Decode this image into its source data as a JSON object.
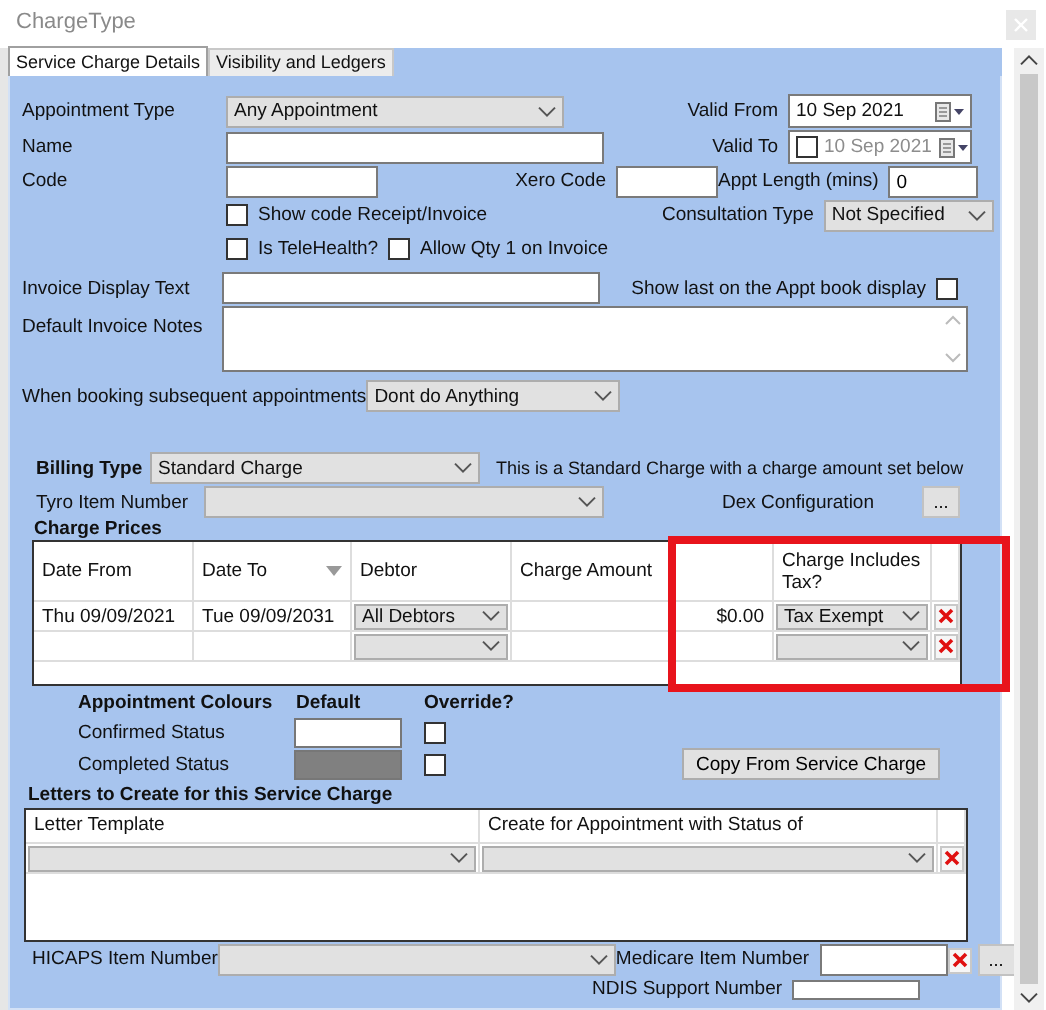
{
  "window": {
    "title": "ChargeType"
  },
  "tabs": [
    {
      "label": "Service Charge Details",
      "selected": true
    },
    {
      "label": "Visibility and Ledgers",
      "selected": false
    }
  ],
  "appointment_type": {
    "label": "Appointment Type",
    "value": "Any Appointment"
  },
  "valid_from": {
    "label": "Valid From",
    "value": "10 Sep 2021"
  },
  "name": {
    "label": "Name"
  },
  "valid_to": {
    "label": "Valid To",
    "value": "10 Sep 2021",
    "checked": false
  },
  "code": {
    "label": "Code"
  },
  "xero_code": {
    "label": "Xero Code"
  },
  "appt_length": {
    "label": "Appt Length (mins)",
    "value": "0"
  },
  "checkboxes": [
    {
      "label": "Show code Receipt/Invoice",
      "checked": false
    },
    {
      "label": "Is TeleHealth?",
      "checked": false
    },
    {
      "label": "Allow Qty 1 on Invoice",
      "checked": false
    }
  ],
  "consultation_type": {
    "label": "Consultation Type",
    "value": "Not Specified"
  },
  "invoice_display_text": {
    "label": "Invoice Display Text"
  },
  "show_last": {
    "label": "Show last on the Appt book display",
    "checked": false
  },
  "default_invoice_notes": {
    "label": "Default Invoice Notes"
  },
  "subsequent_appointments": {
    "label": "When booking subsequent appointments",
    "value": "Dont do Anything"
  },
  "billing_type": {
    "label": "Billing Type",
    "value": "Standard Charge",
    "note": "This is a Standard Charge with a charge amount set below"
  },
  "tyro_item_number": {
    "label": "Tyro Item Number"
  },
  "dex_configuration": {
    "label": "Dex Configuration",
    "button": "..."
  },
  "charge_prices": {
    "title": "Charge Prices",
    "columns": [
      {
        "label": "Date From",
        "sorted": false
      },
      {
        "label": "Date To",
        "sorted": true
      },
      {
        "label": "Debtor",
        "sorted": false
      },
      {
        "label": "Charge Amount",
        "sorted": false
      },
      {
        "label": "Charge Includes Tax?",
        "sorted": false
      }
    ],
    "rows": [
      {
        "kind": "entry",
        "date_from": "Thu 09/09/2021",
        "date_to": "Tue 09/09/2031",
        "debtor": "All Debtors",
        "charge_amount": "$0.00",
        "includes_tax": "Tax Exempt"
      },
      {
        "kind": "new"
      }
    ]
  },
  "appointment_colours": {
    "title": "Appointment Colours",
    "default_heading": "Default",
    "override_heading": "Override?",
    "statuses": [
      {
        "label": "Confirmed Status",
        "color": "#ffffff",
        "override": false
      },
      {
        "label": "Completed Status",
        "color": "#808080",
        "override": false
      }
    ],
    "copy_button": "Copy From Service Charge"
  },
  "letters": {
    "title": "Letters to Create for this Service Charge",
    "columns": [
      "Letter Template",
      "Create for Appointment with Status of"
    ],
    "rows": [
      {
        "kind": "new"
      }
    ]
  },
  "hicaps_item_number": {
    "label": "HICAPS Item Number"
  },
  "medicare_item_number": {
    "label": "Medicare Item Number",
    "button": "..."
  },
  "ndis_support_number": {
    "label": "NDIS Support Number"
  }
}
